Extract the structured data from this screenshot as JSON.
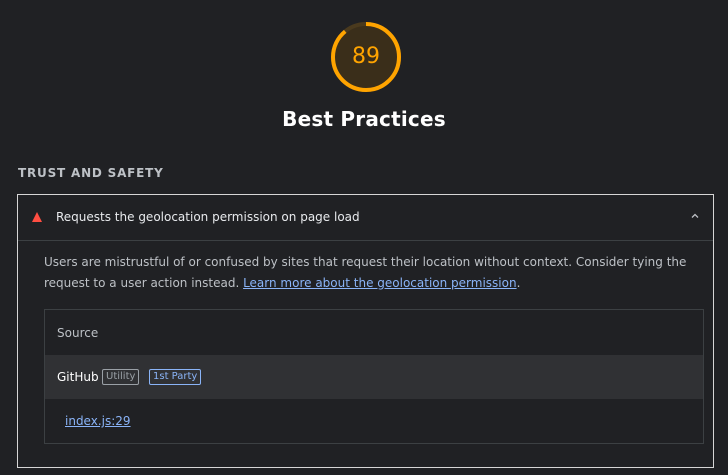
{
  "score": {
    "value": "89",
    "fraction": 0.89,
    "color": "#ffa400"
  },
  "category": {
    "title": "Best Practices"
  },
  "group": {
    "title": "TRUST AND SAFETY"
  },
  "audit": {
    "status_icon": "fail-triangle-icon",
    "status_color": "#ff4e42",
    "title": "Requests the geolocation permission on page load",
    "expand_icon": "chevron-up-icon",
    "description": "Users are mistrustful of or confused by sites that request their location without context. Consider tying the request to a user action instead. ",
    "learn_more": "Learn more about the geolocation permission",
    "description_end": ".",
    "table": {
      "header": "Source",
      "entity": {
        "name": "GitHub",
        "category": "Utility",
        "party": "1st Party"
      },
      "source_url": "index.js:29"
    }
  }
}
